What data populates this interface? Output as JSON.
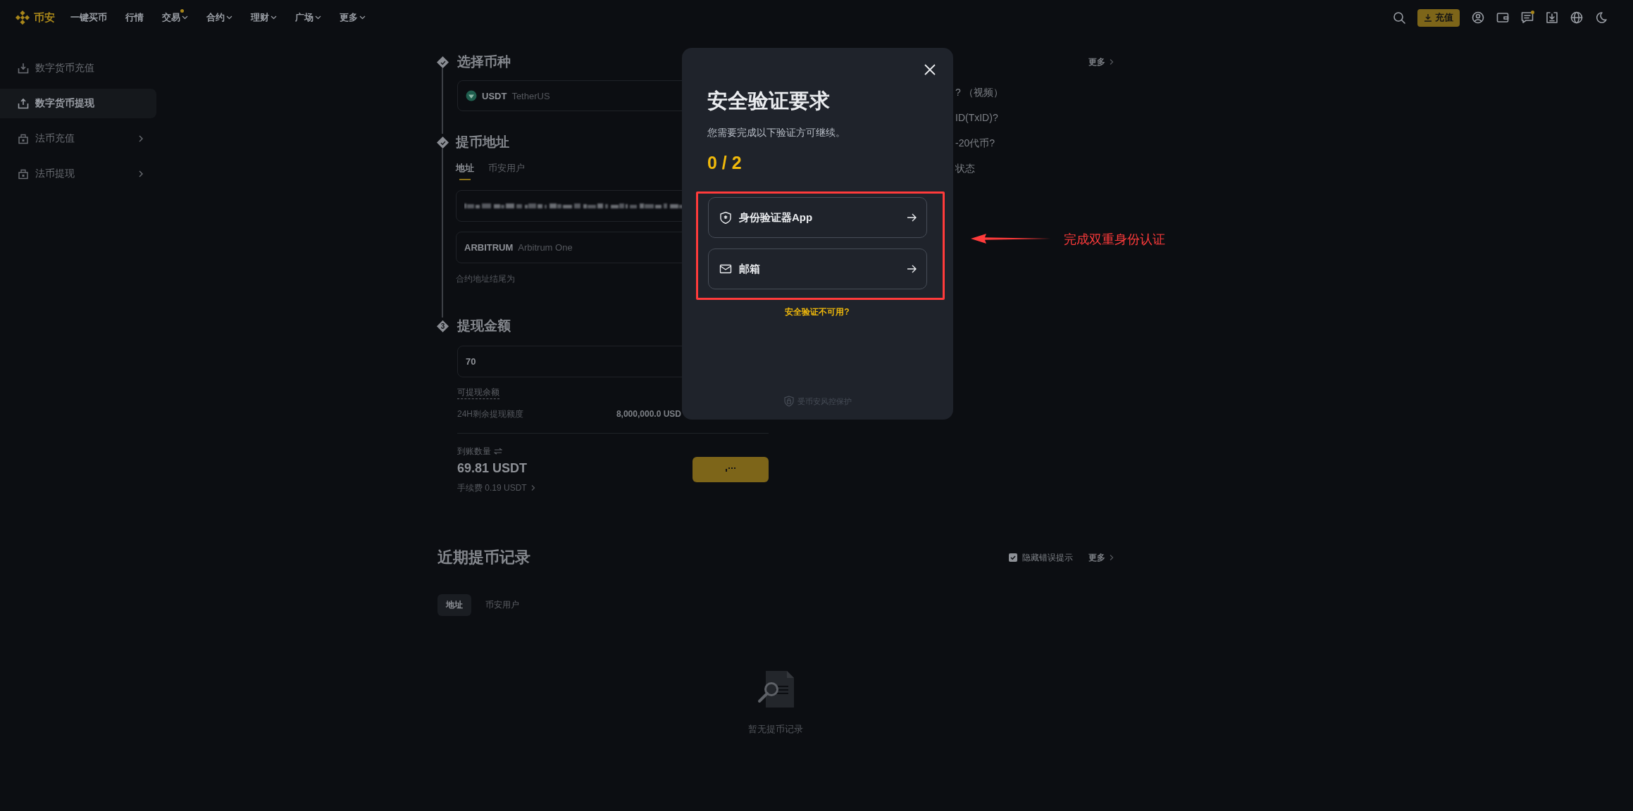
{
  "nav": {
    "logo": "币安",
    "items": [
      {
        "label": "一键买币",
        "dropdown": false,
        "dot": false
      },
      {
        "label": "行情",
        "dropdown": false,
        "dot": false
      },
      {
        "label": "交易",
        "dropdown": true,
        "dot": true
      },
      {
        "label": "合约",
        "dropdown": true,
        "dot": false
      },
      {
        "label": "理财",
        "dropdown": true,
        "dot": false
      },
      {
        "label": "广场",
        "dropdown": true,
        "dot": false
      },
      {
        "label": "更多",
        "dropdown": true,
        "dot": false
      }
    ],
    "deposit_button": "充值"
  },
  "sidebar": {
    "items": [
      {
        "label": "数字货币充值",
        "kind": "download",
        "selected": false,
        "expandable": false
      },
      {
        "label": "数字货币提现",
        "kind": "upload",
        "selected": true,
        "expandable": false
      },
      {
        "label": "法币充值",
        "kind": "bank",
        "selected": false,
        "expandable": true
      },
      {
        "label": "法币提现",
        "kind": "bank",
        "selected": false,
        "expandable": true
      }
    ]
  },
  "steps": [
    {
      "title": "选择币种",
      "done": true
    },
    {
      "title": "提币地址",
      "done": true
    },
    {
      "title": "提现金额",
      "done": false,
      "number": "3"
    }
  ],
  "coin": {
    "symbol": "USDT",
    "name": "TetherUS"
  },
  "address_tabs": [
    {
      "label": "地址",
      "selected": true
    },
    {
      "label": "币安用户",
      "selected": false
    }
  ],
  "network": {
    "code": "ARBITRUM",
    "name": "Arbitrum One"
  },
  "contract_hint": "合约地址结尾为",
  "amount": {
    "value": "70"
  },
  "available_label": "可提现余额",
  "limit": {
    "label": "24H剩余提现额度",
    "value": "8,000,000.0 USD"
  },
  "receive": {
    "label": "到账数量",
    "amount": "69.81 USDT",
    "fee": "手续费 0.19 USDT"
  },
  "submit_button": {
    "loading": true
  },
  "faq": {
    "more": "更多",
    "items": [
      "? （视频）",
      "ID(TxID)?",
      "-20代币?",
      "状态"
    ]
  },
  "modal": {
    "title": "安全验证要求",
    "subtitle": "您需要完成以下验证方可继续。",
    "progress": "0 / 2",
    "options": [
      {
        "kind": "authenticator",
        "label": "身份验证器App"
      },
      {
        "kind": "email",
        "label": "邮箱"
      }
    ],
    "unavailable_link": "安全验证不可用?",
    "footer": "受币安风控保护"
  },
  "annotation": {
    "text": "完成双重身份认证"
  },
  "history": {
    "title": "近期提币记录",
    "hide_errors": {
      "label": "隐藏错误提示",
      "checked": true
    },
    "more": "更多",
    "tabs": [
      {
        "label": "地址",
        "selected": true
      },
      {
        "label": "币安用户",
        "selected": false
      }
    ],
    "empty_text": "暂无提币记录"
  }
}
